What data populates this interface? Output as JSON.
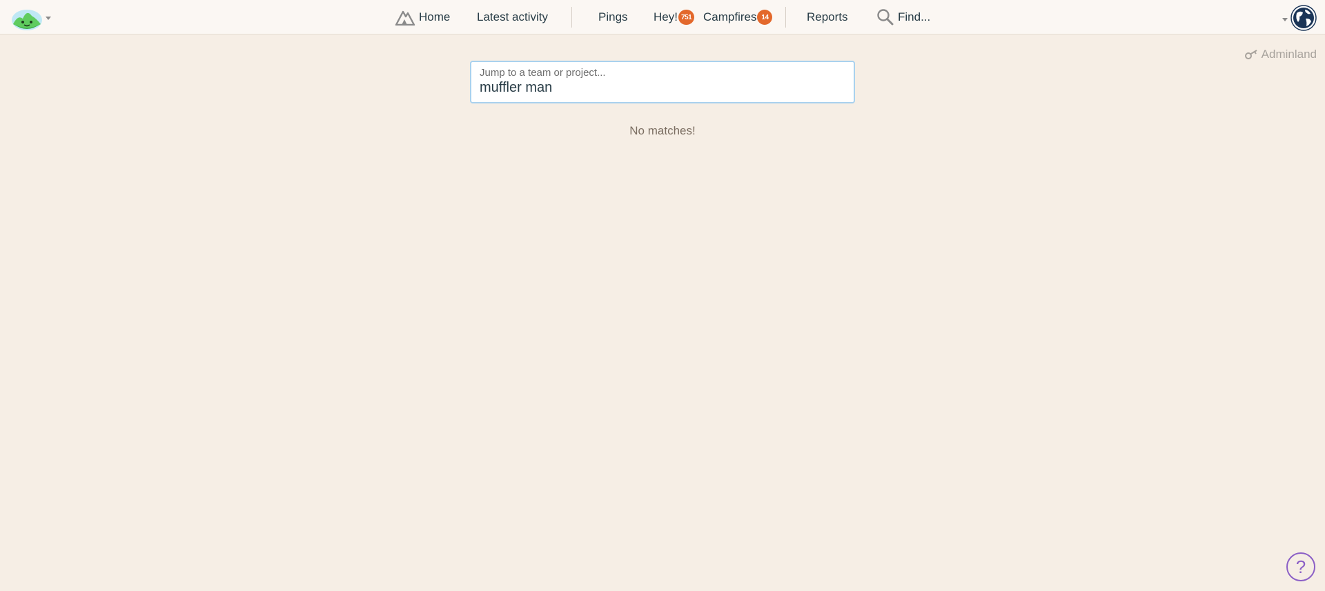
{
  "nav": {
    "home": "Home",
    "latest_activity": "Latest activity",
    "pings": "Pings",
    "hey": "Hey!",
    "hey_count": "751",
    "campfires": "Campfires",
    "campfires_count": "14",
    "reports": "Reports",
    "find": "Find..."
  },
  "adminland": "Adminland",
  "jump": {
    "label": "Jump to a team or project...",
    "value": "muffler man"
  },
  "results_message": "No matches!",
  "help_label": "?",
  "colors": {
    "background": "#f6eee5",
    "badge": "#e3682b",
    "help": "#8b5fc6",
    "input_border": "#a9d1ee"
  },
  "icons": {
    "logo": "basecamp-logo-icon",
    "home": "mountain-home-icon",
    "find": "search-icon",
    "adminland": "key-icon",
    "avatar": "globe-avatar-icon",
    "help": "help-icon"
  }
}
